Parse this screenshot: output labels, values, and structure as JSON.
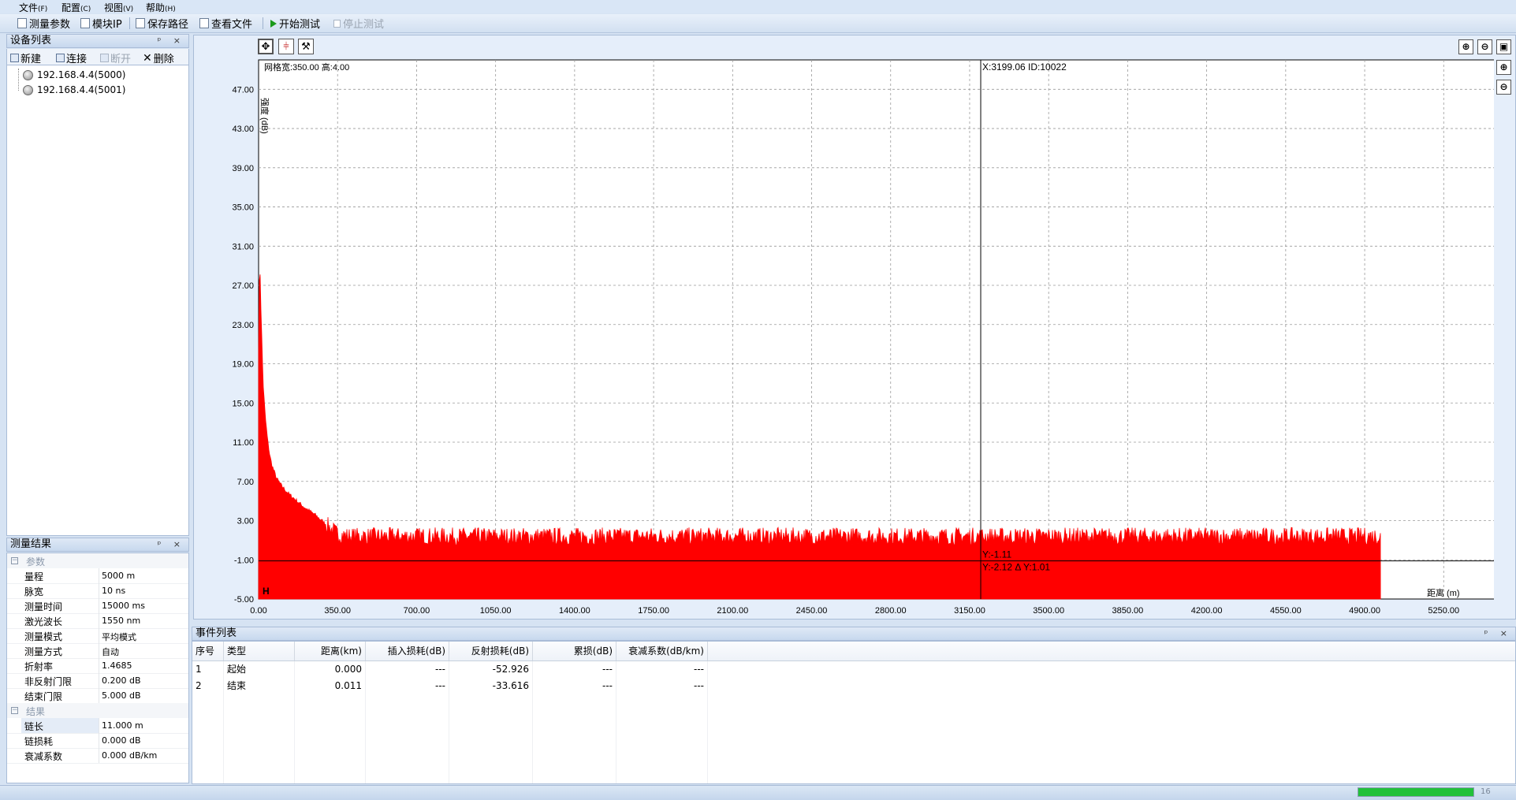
{
  "menu": {
    "items": [
      {
        "label": "文件",
        "hotkey": "(F)"
      },
      {
        "label": "配置",
        "hotkey": "(C)"
      },
      {
        "label": "视图",
        "hotkey": "(V)"
      },
      {
        "label": "帮助",
        "hotkey": "(H)"
      }
    ]
  },
  "toolbar": {
    "measure_params": "测量参数",
    "module_ip": "模块IP",
    "save_path": "保存路径",
    "view_file": "查看文件",
    "start_test": "开始测试",
    "stop_test": "停止测试"
  },
  "device_panel": {
    "title": "设备列表",
    "pin": "ᵖ",
    "close": "×",
    "new": "新建",
    "connect": "连接",
    "disconnect": "断开",
    "delete": "删除",
    "devices": [
      "192.168.4.4(5000)",
      "192.168.4.4(5001)"
    ]
  },
  "result_panel": {
    "title": "测量结果",
    "param_category": "参数",
    "result_category": "结果",
    "params": [
      {
        "k": "量程",
        "v": "5000 m"
      },
      {
        "k": "脉宽",
        "v": "10 ns"
      },
      {
        "k": "测量时间",
        "v": "15000 ms"
      },
      {
        "k": "激光波长",
        "v": "1550 nm"
      },
      {
        "k": "测量模式",
        "v": "平均模式"
      },
      {
        "k": "测量方式",
        "v": "自动"
      },
      {
        "k": "折射率",
        "v": "1.4685"
      },
      {
        "k": "非反射门限",
        "v": "0.200 dB"
      },
      {
        "k": "结束门限",
        "v": "5.000 dB"
      }
    ],
    "results": [
      {
        "k": "链长",
        "v": "11.000 m"
      },
      {
        "k": "链损耗",
        "v": "0.000 dB"
      },
      {
        "k": "衰减系数",
        "v": "0.000 dB/km"
      }
    ]
  },
  "chart": {
    "grid_info": "网格宽:350.00 高:4.00",
    "cursor_info": "X:3199.06  ID:10022",
    "y_info": "Y:-1.11",
    "dy_info": "Y:-2.12 Δ Y:1.01",
    "xlabel": "距离 (m)",
    "ylabel": "强度 (dB)",
    "marker": "H"
  },
  "chart_data": {
    "type": "line",
    "xlabel": "距离 (m)",
    "ylabel": "强度 (dB)",
    "xlim": [
      0,
      5490
    ],
    "ylim": [
      -5,
      50
    ],
    "x_ticks": [
      "0.00",
      "350.00",
      "700.00",
      "1050.00",
      "1400.00",
      "1750.00",
      "2100.00",
      "2450.00",
      "2800.00",
      "3150.00",
      "3500.00",
      "3850.00",
      "4200.00",
      "4550.00",
      "4900.00",
      "5250.00"
    ],
    "y_ticks": [
      "47.00",
      "43.00",
      "39.00",
      "35.00",
      "31.00",
      "27.00",
      "23.00",
      "19.00",
      "15.00",
      "11.00",
      "7.00",
      "3.00",
      "-1.00",
      "-5.00"
    ],
    "grid": true,
    "cursor_x": 3199.06,
    "cursor_y": -1.11,
    "series": [
      {
        "color": "#ff0000",
        "x": [
          0,
          5,
          10,
          15,
          20,
          30,
          40,
          50,
          60,
          80,
          100,
          130,
          160,
          200,
          250,
          300,
          350,
          400,
          600,
          1000,
          1500,
          2000,
          2500,
          3000,
          3500,
          4000,
          4500,
          4970
        ],
        "y": [
          20.5,
          30.3,
          25.0,
          21.0,
          17.0,
          13.5,
          11.2,
          9.6,
          8.6,
          7.3,
          6.6,
          5.8,
          5.2,
          4.4,
          3.6,
          2.6,
          1.6,
          1.4,
          1.4,
          1.4,
          1.4,
          1.4,
          1.4,
          1.4,
          1.4,
          1.4,
          1.4,
          1.4
        ],
        "noise_floor": -1.1,
        "noise_band": 1.5
      }
    ]
  },
  "events": {
    "title": "事件列表",
    "columns": [
      "序号",
      "类型",
      "距离(km)",
      "插入损耗(dB)",
      "反射损耗(dB)",
      "累损(dB)",
      "衰减系数(dB/km)"
    ],
    "rows": [
      [
        "1",
        "起始",
        "0.000",
        "---",
        "-52.926",
        "---",
        "---"
      ],
      [
        "2",
        "结束",
        "0.011",
        "---",
        "-33.616",
        "---",
        "---"
      ]
    ]
  },
  "status": {
    "progress": 1.0,
    "right_text": "16"
  }
}
